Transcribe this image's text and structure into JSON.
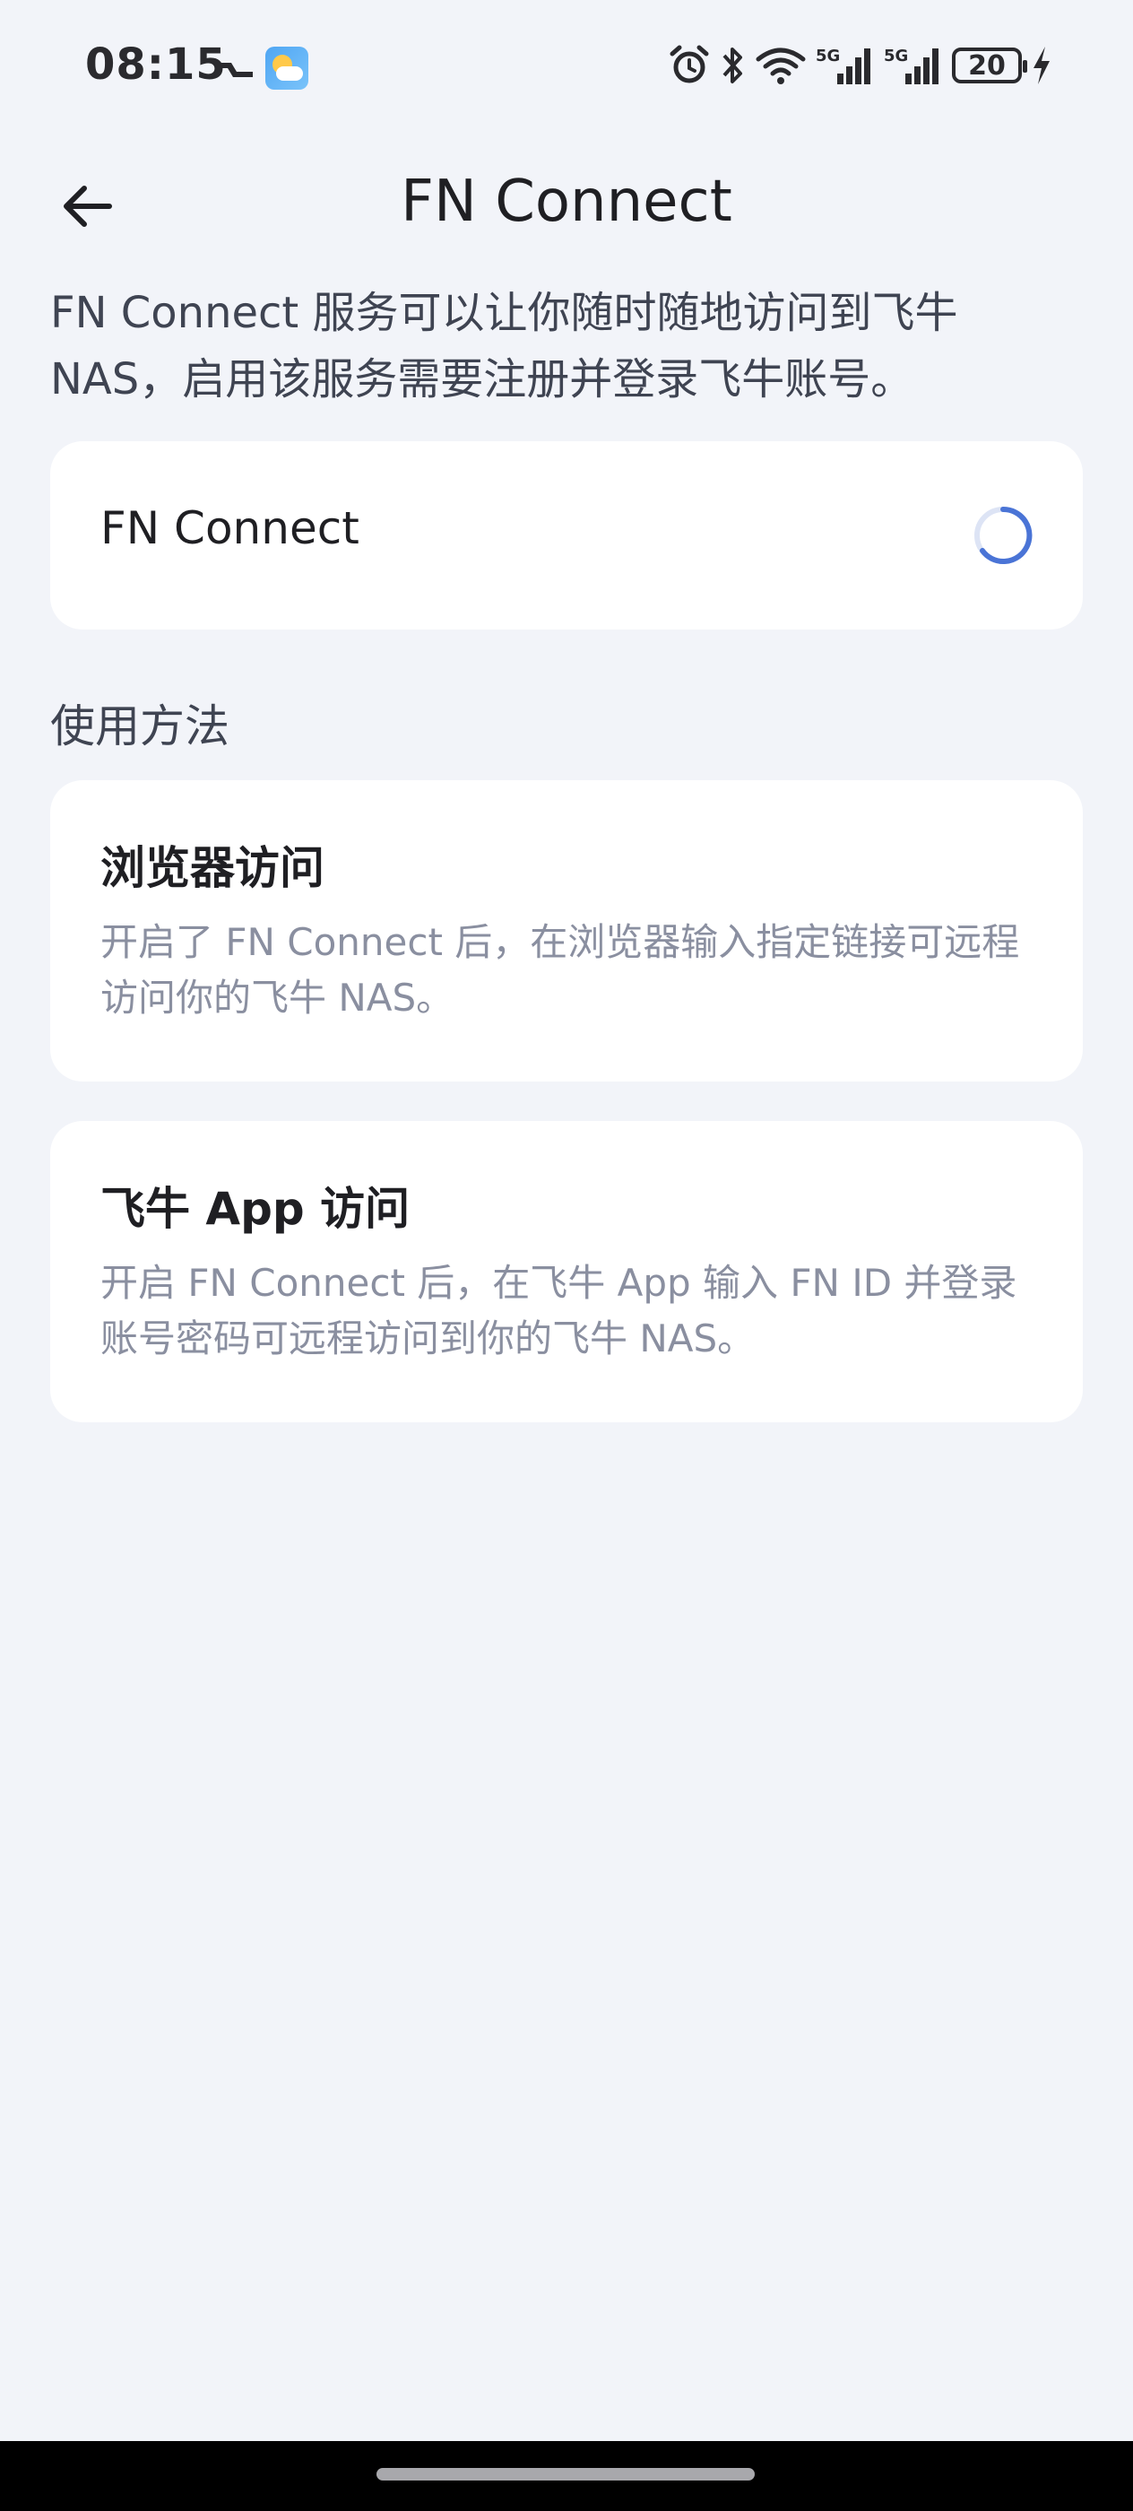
{
  "status_bar": {
    "time": "08:15",
    "battery_level": "20",
    "icons": [
      "notification-icon",
      "weather-icon",
      "alarm-icon",
      "bluetooth-icon",
      "wifi-icon",
      "signal-5g-icon",
      "signal-5g-icon",
      "battery-icon",
      "charging-icon"
    ]
  },
  "header": {
    "title": "FN Connect",
    "back_icon": "arrow-left-icon"
  },
  "intro": {
    "text": "FN Connect 服务可以让你随时随地访问到飞牛 NAS，启用该服务需要注册并登录飞牛账号。"
  },
  "toggle": {
    "label": "FN Connect",
    "state": "loading"
  },
  "usage": {
    "section_title": "使用方法",
    "items": [
      {
        "title": "浏览器访问",
        "description": "开启了 FN Connect 后，在浏览器输入指定链接可远程访问你的飞牛 NAS。"
      },
      {
        "title": "飞牛 App 访问",
        "description": "开启 FN Connect 后，在飞牛 App 输入 FN ID 并登录账号密码可远程访问到你的飞牛 NAS。"
      }
    ]
  },
  "colors": {
    "background": "#F2F4F9",
    "card": "#FFFFFF",
    "accent": "#4A74D6",
    "muted_text": "#8A8FA0"
  }
}
